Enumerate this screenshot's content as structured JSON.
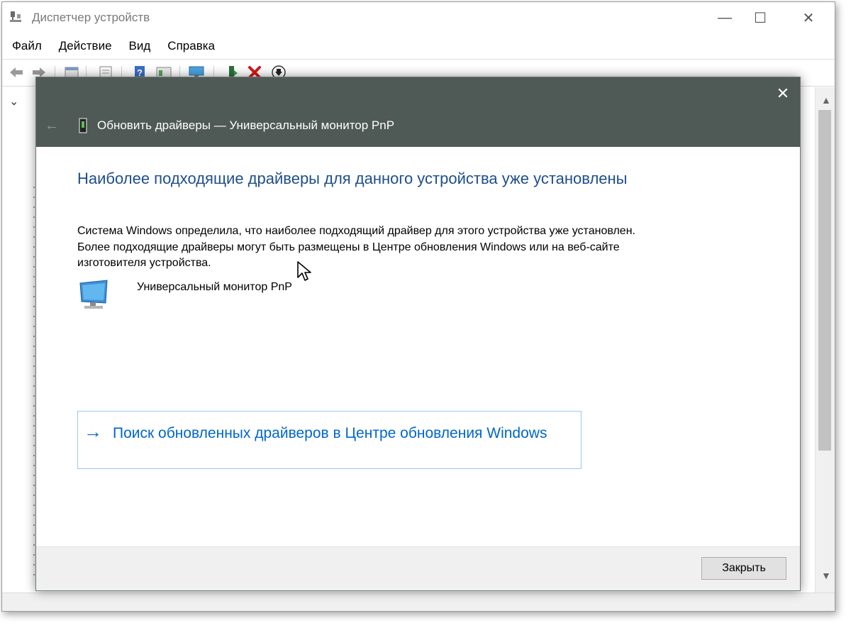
{
  "window": {
    "title": "Диспетчер устройств",
    "minimize_glyph": "—",
    "maximize_glyph": "☐",
    "close_glyph": "✕"
  },
  "menu": [
    "Файл",
    "Действие",
    "Вид",
    "Справка"
  ],
  "toolbar_icons": [
    "back-arrow-icon",
    "forward-arrow-icon",
    "properties-icon",
    "show-hidden-icon",
    "help-icon",
    "view-icon",
    "monitor-scan-icon",
    "update-driver-icon",
    "uninstall-icon",
    "disable-download-icon"
  ],
  "dialog": {
    "title": "Обновить драйверы — Универсальный монитор PnP",
    "close_glyph": "✕",
    "back_glyph": "←",
    "headline": "Наиболее подходящие драйверы для данного устройства уже установлены",
    "body": "Система Windows определила, что наиболее подходящий драйвер для этого устройства уже установлен. Более подходящие драйверы могут быть размещены в Центре обновления Windows или на веб-сайте изготовителя устройства.",
    "device_name": "Универсальный монитор PnP",
    "search_link": "Поиск обновленных драйверов в Центре обновления Windows",
    "link_arrow": "→",
    "close_button": "Закрыть"
  },
  "colors": {
    "dialog_header": "#4f5955",
    "headline": "#1e4e8c",
    "link": "#0066cc",
    "link_border": "#9ec6ea",
    "delete_red": "#d41717"
  }
}
